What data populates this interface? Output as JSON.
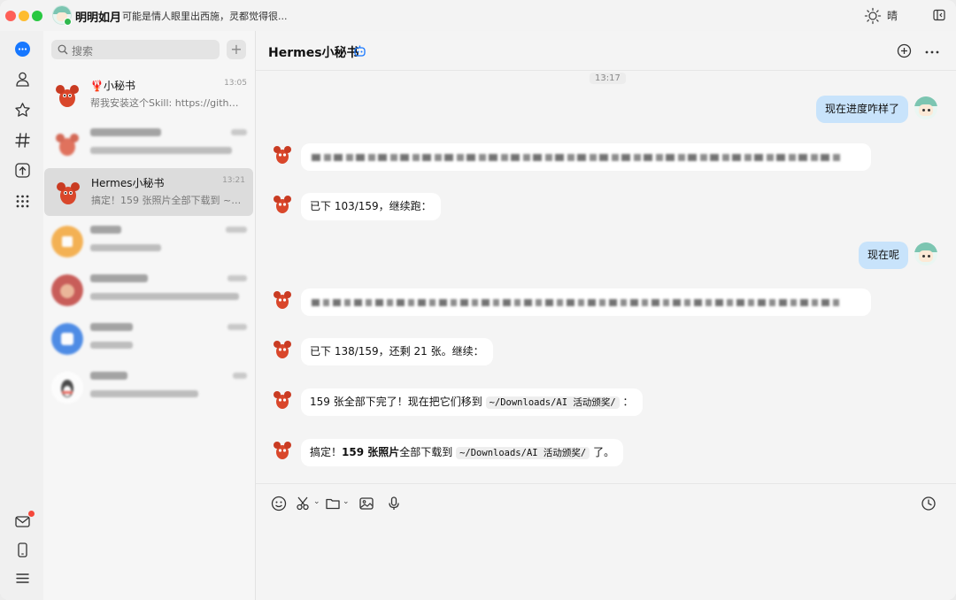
{
  "titlebar": {
    "nickname": "明明如月",
    "signature": "可能是情人眼里出西施，灵都觉得很...",
    "weather": "晴"
  },
  "nav": {
    "items": [
      "chat-icon",
      "contacts-icon",
      "favorites-icon",
      "channels-icon",
      "upload-icon",
      "apps-icon",
      "mail-icon",
      "phone-icon",
      "menu-icon"
    ]
  },
  "sidebar": {
    "search_placeholder": "搜索",
    "conversations": [
      {
        "name": "🦞小秘书",
        "time": "13:05",
        "preview": "帮我安装这个Skill: https://github.c..."
      },
      {
        "name": "",
        "time": "",
        "preview": ""
      },
      {
        "name": "Hermes小秘书",
        "time": "13:21",
        "preview": "搞定！159 张照片全部下载到 ~/Do..."
      },
      {
        "name": "",
        "time": "",
        "preview": ""
      },
      {
        "name": "",
        "time": "",
        "preview": ""
      },
      {
        "name": "",
        "time": "",
        "preview": ""
      },
      {
        "name": "",
        "time": "",
        "preview": ""
      }
    ]
  },
  "chat": {
    "title": "Hermes小秘书",
    "timestamp": "13:17",
    "messages": [
      {
        "from": "me",
        "text": "现在进度咋样了"
      },
      {
        "from": "bot",
        "text": ""
      },
      {
        "from": "bot",
        "text": "已下 103/159，继续跑："
      },
      {
        "from": "me",
        "text": "现在呢"
      },
      {
        "from": "bot",
        "text": ""
      },
      {
        "from": "bot",
        "text": "已下 138/159，还剩 21 张。继续："
      },
      {
        "from": "bot",
        "text_pre": "159 张全部下完了！现在把它们移到",
        "code": "~/Downloads/AI 活动颁奖/",
        "text_post": "："
      },
      {
        "from": "bot",
        "text_pre": "搞定！",
        "bold": "159 张照片",
        "text_mid": "全部下载到",
        "code": "~/Downloads/AI 活动颁奖/",
        "text_post": "了。"
      }
    ]
  },
  "colors": {
    "accent": "#1677ff",
    "out_bubble": "#c8e3fb",
    "badge": "#f5483b"
  }
}
